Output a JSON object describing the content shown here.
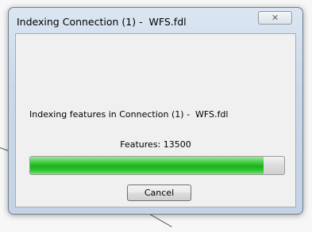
{
  "dialog": {
    "title": "Indexing Connection (1) -  WFS.fdl",
    "close_icon": "close-icon"
  },
  "content": {
    "message": "Indexing features in Connection (1) -  WFS.fdl",
    "features_text": "Features: 13500",
    "progress_fraction": 0.92,
    "progress_color": "#1bb11b",
    "cancel_label": "Cancel"
  }
}
